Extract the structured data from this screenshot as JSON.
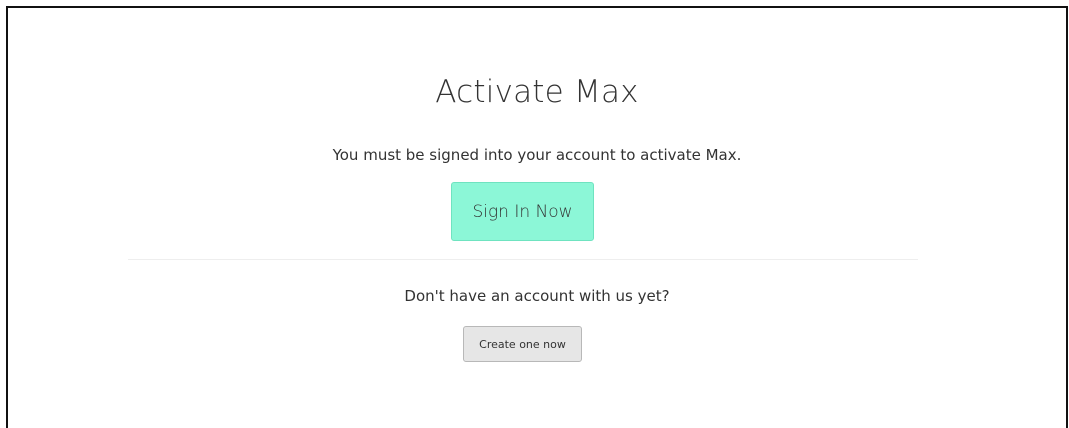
{
  "page": {
    "title": "Activate Max",
    "subtitle": "You must be signed into your account to activate Max.",
    "signin_label": "Sign In Now",
    "prompt": "Don't have an account with us yet?",
    "create_label": "Create one now"
  },
  "colors": {
    "signin_bg": "#8cf7d7",
    "signin_border": "#6fe3c0",
    "create_bg": "#e6e6e6",
    "create_border": "#b8b8b8",
    "text": "#333333",
    "frame_border": "#111111"
  }
}
